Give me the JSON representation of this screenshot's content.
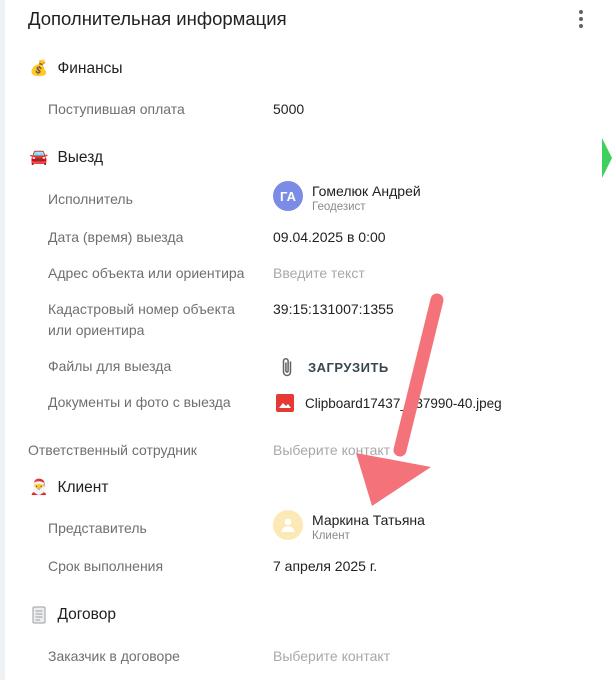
{
  "header": {
    "title": "Дополнительная информация",
    "menu_icon": "more-vert-icon"
  },
  "finance": {
    "title": "Финансы",
    "icon": "money-bag-icon",
    "payment_label": "Поступившая оплата",
    "payment_value": "5000"
  },
  "trip": {
    "title": "Выезд",
    "icon": "car-icon",
    "executor_label": "Исполнитель",
    "executor": {
      "initials": "ГА",
      "name": "Гомелюк Андрей",
      "role": "Геодезист",
      "avatar_color": "#7c8ce6"
    },
    "date_label": "Дата (время) выезда",
    "date_value": "09.04.2025 в 0:00",
    "address_label": "Адрес объекта или ориентира",
    "address_placeholder": "Введите текст",
    "cadastral_label": "Кадастровый номер объекта или ориентира",
    "cadastral_value": "39:15:131007:1355",
    "files_label": "Файлы для выезда",
    "upload_label": "ЗАГРУЗИТЬ",
    "docs_label": "Документы и фото с выезда",
    "doc_file": "Clipboard17437_537990-40.jpeg"
  },
  "responsible": {
    "label": "Ответственный сотрудник",
    "placeholder": "Выберите контакт"
  },
  "client": {
    "title": "Клиент",
    "icon": "santa-icon",
    "rep_label": "Представитель",
    "rep": {
      "name": "Маркина Татьяна",
      "role": "Клиент",
      "avatar_color": "#fde9b6"
    },
    "deadline_label": "Срок выполнения",
    "deadline_value": "7 апреля 2025 г."
  },
  "contract": {
    "title": "Договор",
    "icon": "document-icon",
    "customer_label": "Заказчик в договоре",
    "customer_placeholder": "Выберите контакт"
  },
  "colors": {
    "annotation_arrow": "#f4737b",
    "accent_green": "#3ecf5d",
    "file_icon": "#e53935"
  }
}
